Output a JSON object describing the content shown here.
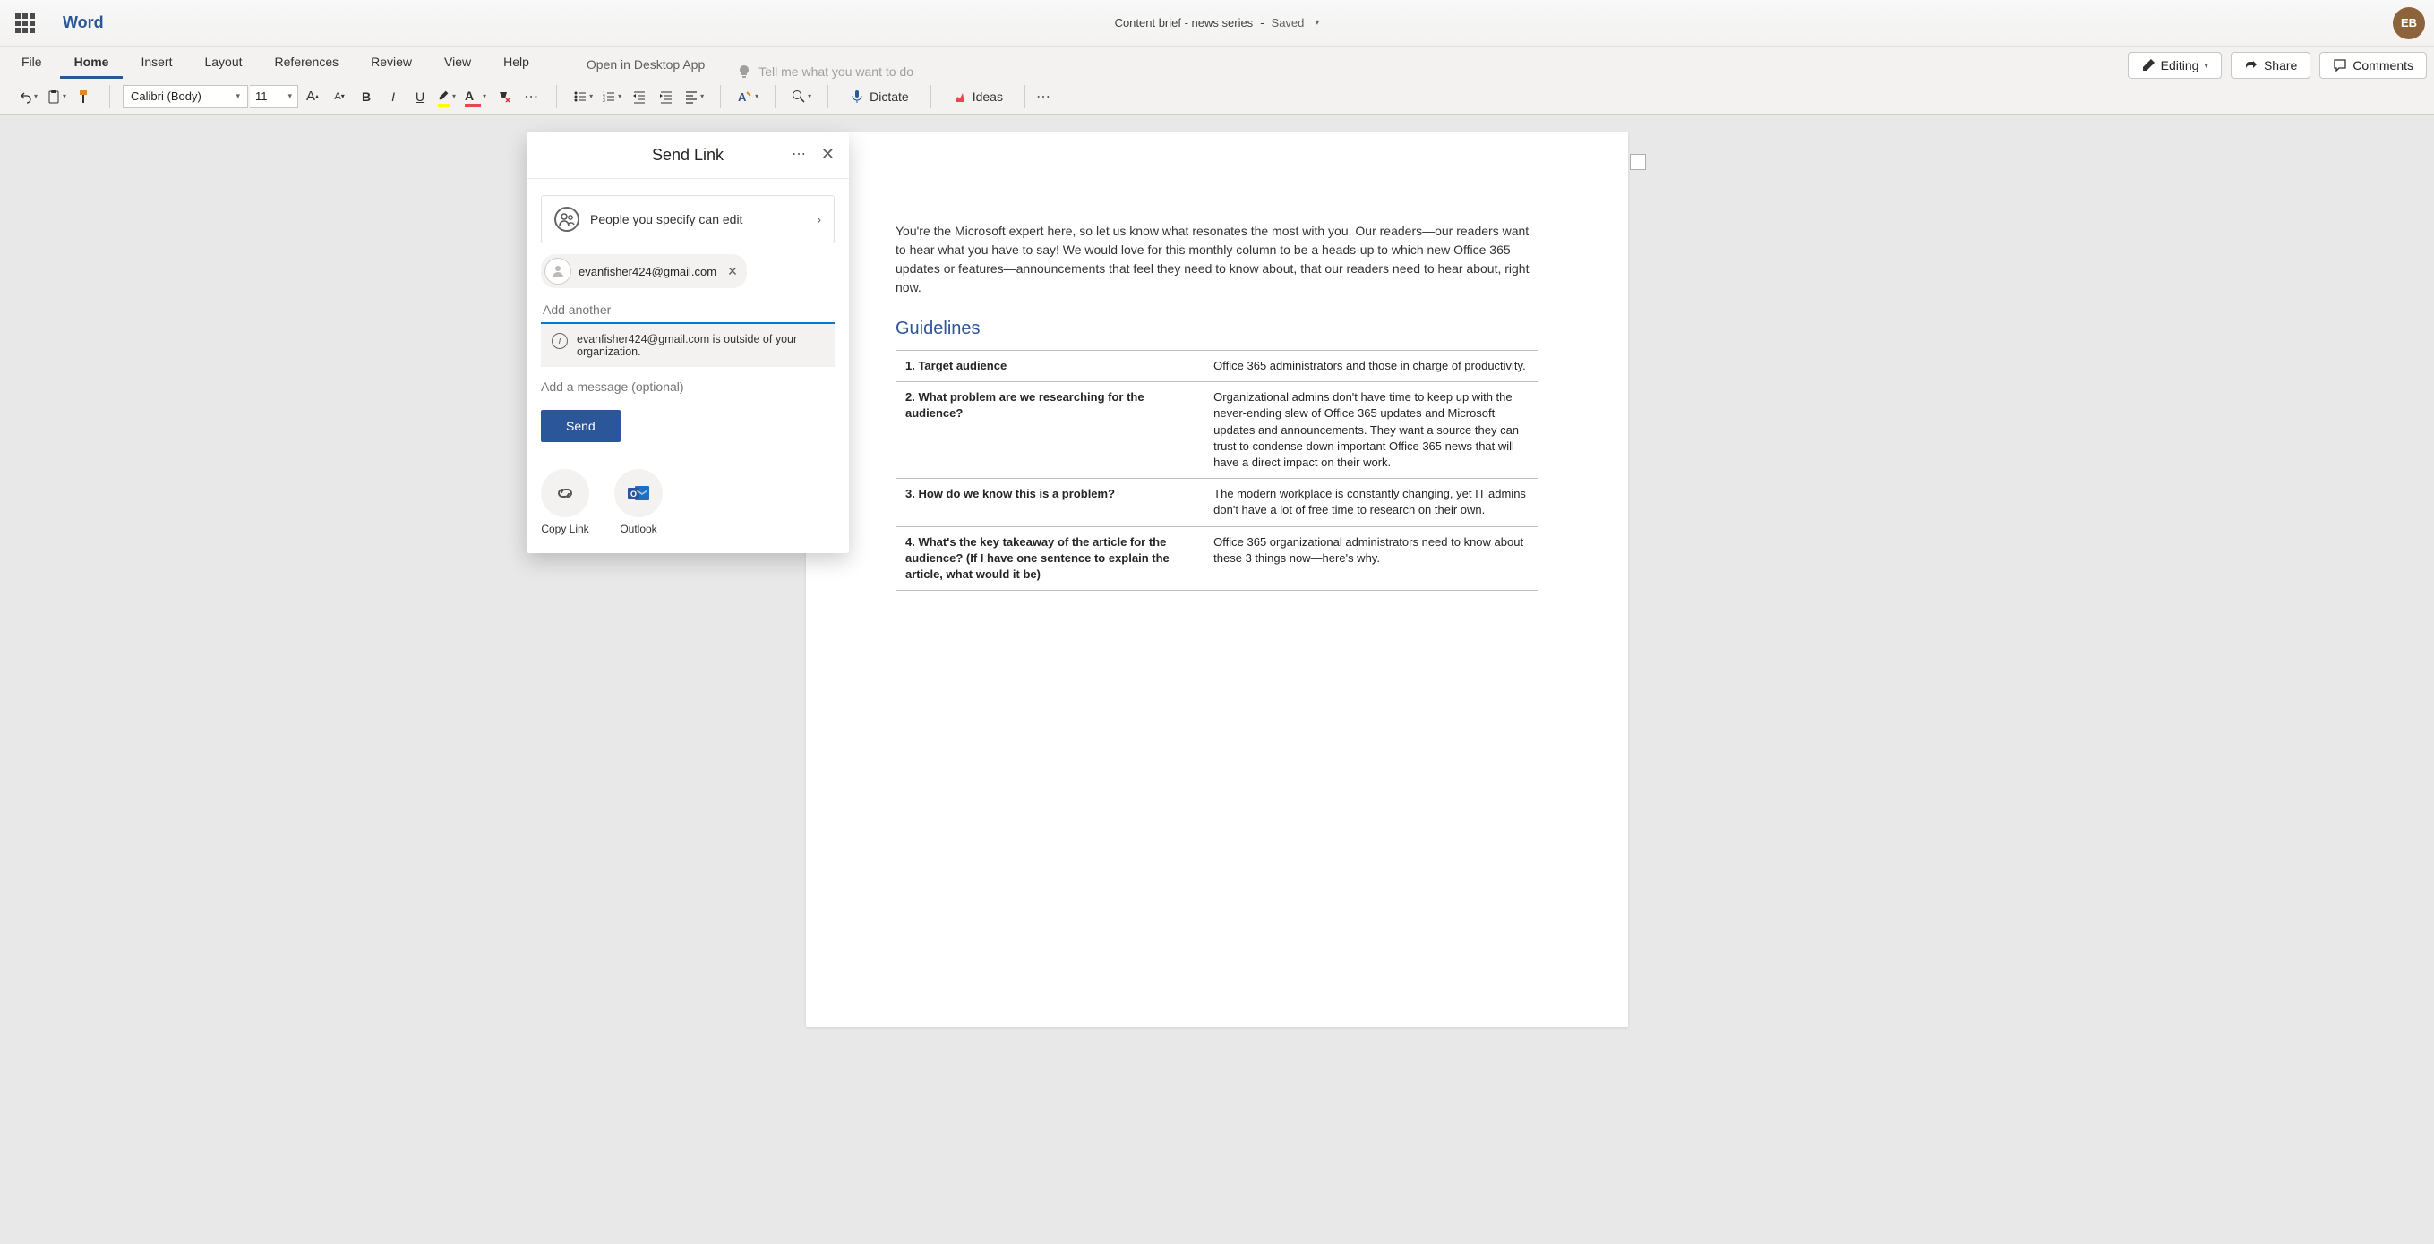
{
  "brand": "Word",
  "doc": {
    "title": "Content brief - news series",
    "status": "Saved"
  },
  "avatar_initials": "EB",
  "tabs": {
    "file": "File",
    "home": "Home",
    "insert": "Insert",
    "layout": "Layout",
    "references": "References",
    "review": "Review",
    "view": "View",
    "help": "Help",
    "open_desktop": "Open in Desktop App",
    "tell_me": "Tell me what you want to do",
    "editing": "Editing",
    "share": "Share",
    "comments": "Comments"
  },
  "ribbon": {
    "font_family": "Calibri (Body)",
    "font_size": "11",
    "dictate": "Dictate",
    "ideas": "Ideas"
  },
  "document": {
    "intro": "You're the Microsoft expert here, so let us know what resonates the most with you. Our readers—our readers want to hear what you have to say! We would love for this monthly column to be a heads-up to which new Office 365 updates or features—announcements that feel they need to know about, that our readers need to hear about, right now.",
    "guidelines_heading": "Guidelines",
    "table": [
      {
        "q": "1. Target audience",
        "a": "Office 365 administrators and those in charge of productivity."
      },
      {
        "q": "2. What problem are we researching for the audience?",
        "a": "Organizational admins don't have time to keep up with the never-ending slew of Office 365 updates and Microsoft updates and announcements. They want a source they can trust to condense down important Office 365 news that will have a direct impact on their work."
      },
      {
        "q": "3. How do we know this is a problem?",
        "a": "The modern workplace is constantly changing, yet IT admins don't have a lot of free time to research on their own."
      },
      {
        "q": "4. What's the key takeaway of the article for the audience? (If I have one sentence to explain the article, what would it be)",
        "a": "Office 365 organizational administrators need to know about these 3 things now—here's why."
      }
    ]
  },
  "flyout": {
    "title": "Send Link",
    "permission": "People you specify can edit",
    "recipient_email": "evanfisher424@gmail.com",
    "add_placeholder": "Add another",
    "info": "evanfisher424@gmail.com is outside of your organization.",
    "message_placeholder": "Add a message (optional)",
    "send": "Send",
    "copy_link": "Copy Link",
    "outlook": "Outlook"
  }
}
